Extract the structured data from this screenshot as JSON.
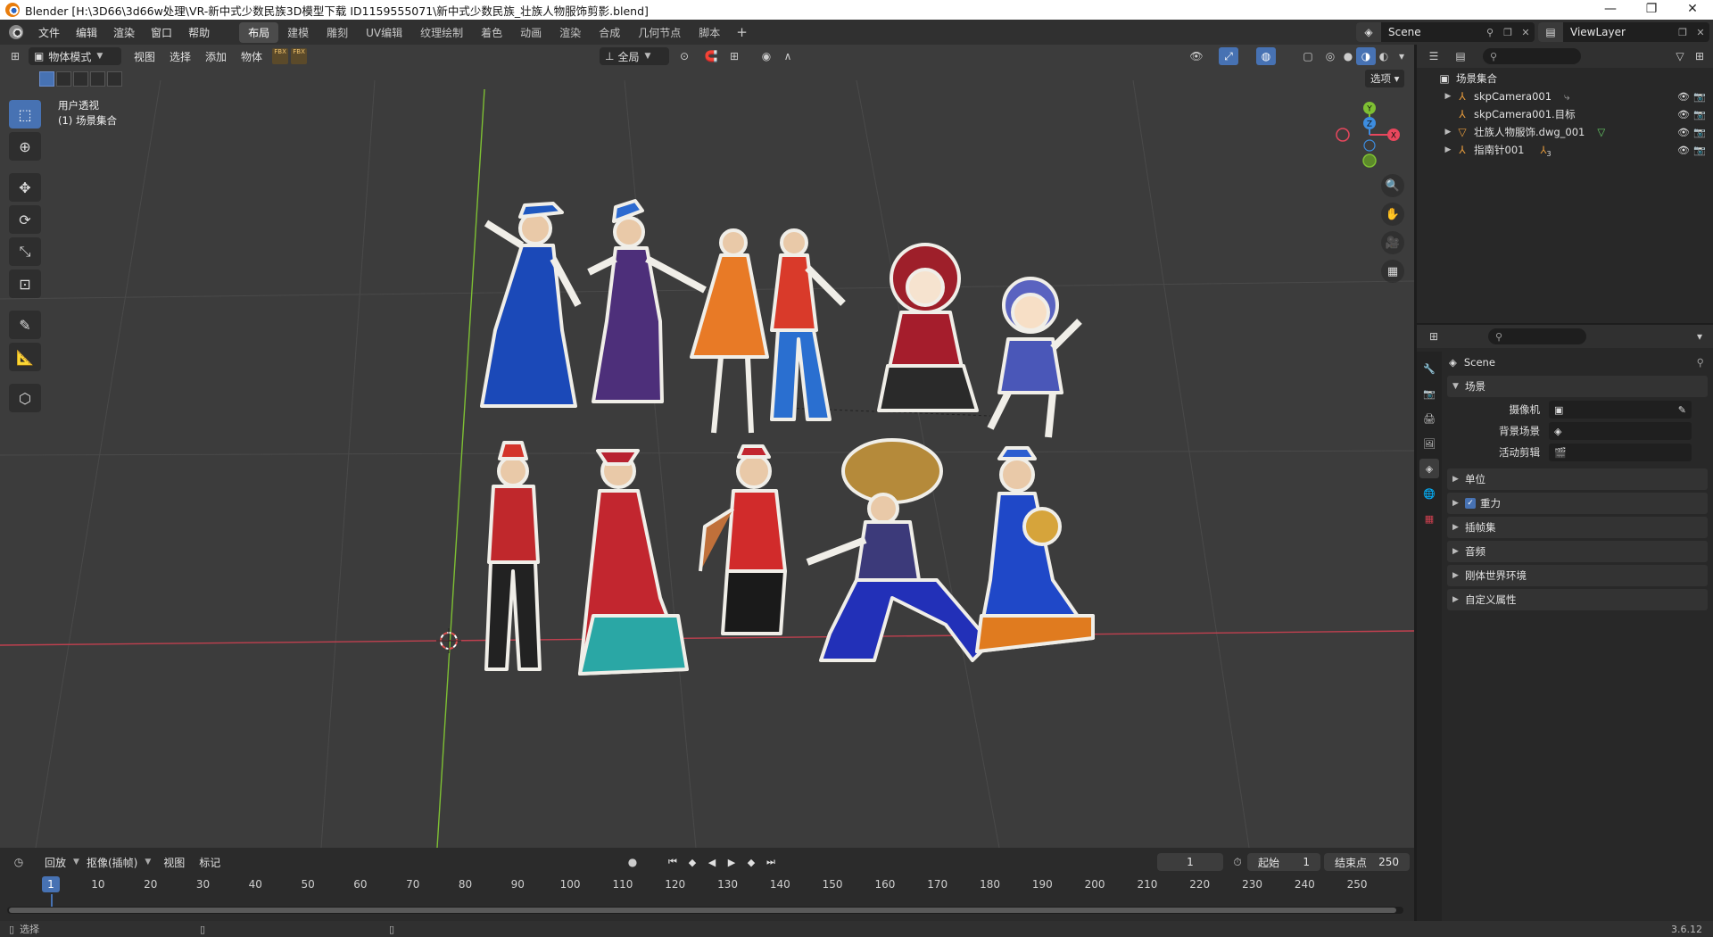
{
  "titlebar": {
    "title": "Blender [H:\\3D66\\3d66w处理\\VR-新中式少数民族3D模型下载 ID1159555071\\新中式少数民族_壮族人物服饰剪影.blend]",
    "minimize": "—",
    "restore": "❐",
    "close": "✕"
  },
  "menubar": {
    "menus": [
      "文件",
      "编辑",
      "渲染",
      "窗口",
      "帮助"
    ],
    "workspaces": [
      "布局",
      "建模",
      "雕刻",
      "UV编辑",
      "纹理绘制",
      "着色",
      "动画",
      "渲染",
      "合成",
      "几何节点",
      "脚本"
    ],
    "active_workspace": "布局",
    "add_workspace": "+",
    "scene_name": "Scene",
    "view_layer": "ViewLayer"
  },
  "viewport": {
    "mode": "物体模式",
    "menus": [
      "视图",
      "选择",
      "添加",
      "物体"
    ],
    "transform_orientation": "全局",
    "options_label": "选项",
    "info_line1": "用户透视",
    "info_line2": "(1) 场景集合",
    "fbx_label": "FBX",
    "gizmo_axes": [
      "X",
      "Y",
      "Z"
    ],
    "background_color": "#3c3c3c"
  },
  "timeline": {
    "menus": [
      "回放",
      "抠像(插帧)",
      "视图",
      "标记"
    ],
    "current_frame": "1",
    "start_label": "起始",
    "start_value": "1",
    "end_label": "结束点",
    "end_value": "250",
    "ruler": [
      "10",
      "20",
      "30",
      "40",
      "50",
      "60",
      "70",
      "80",
      "90",
      "100",
      "110",
      "120",
      "130",
      "140",
      "150",
      "160",
      "170",
      "180",
      "190",
      "200",
      "210",
      "220",
      "230",
      "240",
      "250"
    ],
    "cursor_value": "1"
  },
  "statusbar": {
    "select_label": "选择",
    "version": "3.6.12"
  },
  "outliner": {
    "root": "场景集合",
    "items": [
      {
        "label": "skpCamera001",
        "expandable": true
      },
      {
        "label": "skpCamera001.目标",
        "expandable": false
      },
      {
        "label": "壮族人物服饰.dwg_001",
        "expandable": true
      },
      {
        "label": "指南针001",
        "expandable": true,
        "badge": "3"
      }
    ]
  },
  "properties": {
    "context": "Scene",
    "scene_panel": "场景",
    "camera_label": "摄像机",
    "background_scene_label": "背景场景",
    "active_clip_label": "活动剪辑",
    "panels": [
      "单位",
      "重力",
      "插帧集",
      "音频",
      "刚体世界环境",
      "自定义属性"
    ],
    "gravity_checked": true
  },
  "colors": {
    "accent": "#4772b3",
    "x_axis": "#e8475d",
    "y_axis": "#7ec033",
    "z_axis": "#3d8de0"
  }
}
